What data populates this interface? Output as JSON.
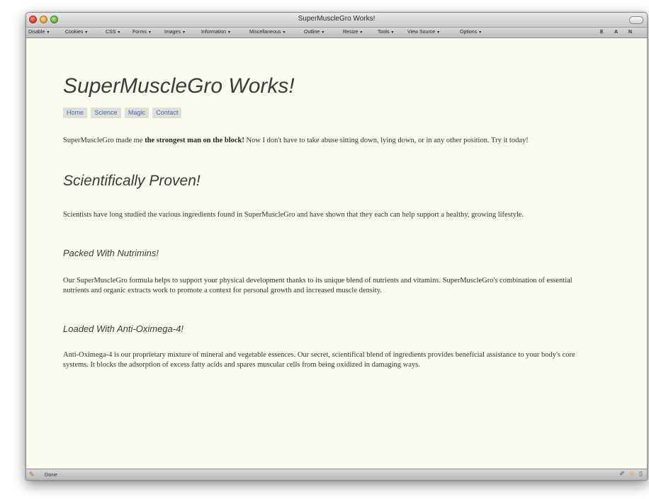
{
  "window": {
    "title": "SuperMuscleGro Works!"
  },
  "devbar": {
    "menus": [
      {
        "label": "Disable"
      },
      {
        "label": "Cookies"
      },
      {
        "label": "CSS"
      },
      {
        "label": "Forms"
      },
      {
        "label": "Images"
      },
      {
        "label": "Information"
      },
      {
        "label": "Miscellaneous"
      },
      {
        "label": "Outline"
      },
      {
        "label": "Resize"
      },
      {
        "label": "Tools"
      },
      {
        "label": "View Source"
      },
      {
        "label": "Options"
      }
    ],
    "flags": [
      "E",
      "A",
      "N"
    ]
  },
  "page": {
    "title": "SuperMuscleGro Works!",
    "nav": [
      "Home",
      "Science",
      "Magic",
      "Contact"
    ],
    "intro": {
      "before": "SuperMuscleGro made me ",
      "bold": "the strongest man on the block!",
      "after": " Now I don't have to take abuse sitting down, lying down, or in any other position. Try it today!"
    },
    "section_heading": "Scientifically Proven!",
    "science_text": "Scientists have long studied the various ingredients found in SuperMuscleGro and have shown that they each can help support a healthy, growing lifestyle.",
    "nutrimins_heading": "Packed With Nutrimins!",
    "nutrimins_text": "Our SuperMuscleGro formula helps to support your physical development thanks to its unique blend of nutrients and vitamins. SuperMuscleGro's combination of essential nutrients and organic extracts work to promote a context for personal growth and increased muscle density.",
    "oximega_heading": "Loaded With Anti-Oximega-4!",
    "oximega_text": "Anti-Oximega-4 is our proprietary mixture of mineral and vegetable essences. Our secret, scientifical blend of ingredients provides beneficial assistance to your body's core systems. It blocks the adsorption of excess fatty acids and spares muscular cells from being oxidized in damaging ways."
  },
  "statusbar": {
    "text": "Done",
    "icons": [
      "pencil-icon",
      "smiley-icon",
      "page-icon"
    ]
  }
}
